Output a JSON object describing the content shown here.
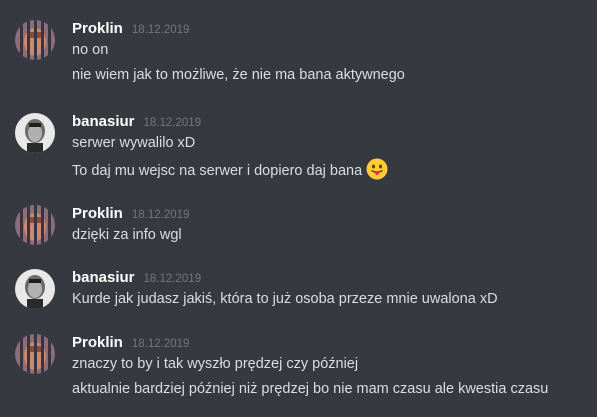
{
  "messages": [
    {
      "username": "Proklin",
      "timestamp": "18.12.2019",
      "avatar_icon": "proklin-avatar-icon",
      "lines": [
        "no on",
        "nie wiem jak to możliwe, że nie ma bana aktywnego"
      ]
    },
    {
      "username": "banasiur",
      "timestamp": "18.12.2019",
      "avatar_icon": "banasiur-avatar-icon",
      "lines": [
        "serwer wywalilo xD",
        "To daj mu wejsc na serwer i dopiero daj bana"
      ],
      "emoji": "tongue-out-emoji-icon"
    },
    {
      "username": "Proklin",
      "timestamp": "18.12.2019",
      "avatar_icon": "proklin-avatar-icon",
      "lines": [
        "dzięki za info wgl"
      ]
    },
    {
      "username": "banasiur",
      "timestamp": "18.12.2019",
      "avatar_icon": "banasiur-avatar-icon",
      "lines": [
        "Kurde jak judasz jakiś, która to już osoba przeze mnie uwalona xD"
      ]
    },
    {
      "username": "Proklin",
      "timestamp": "18.12.2019",
      "avatar_icon": "proklin-avatar-icon",
      "lines": [
        "znaczy to by i tak wyszło prędzej czy później",
        "aktualnie bardziej później niż prędzej bo nie mam czasu ale kwestia czasu"
      ]
    }
  ],
  "colors": {
    "background": "#36393f",
    "username": "#ffffff",
    "timestamp": "#72767d",
    "text": "#dcddde"
  }
}
